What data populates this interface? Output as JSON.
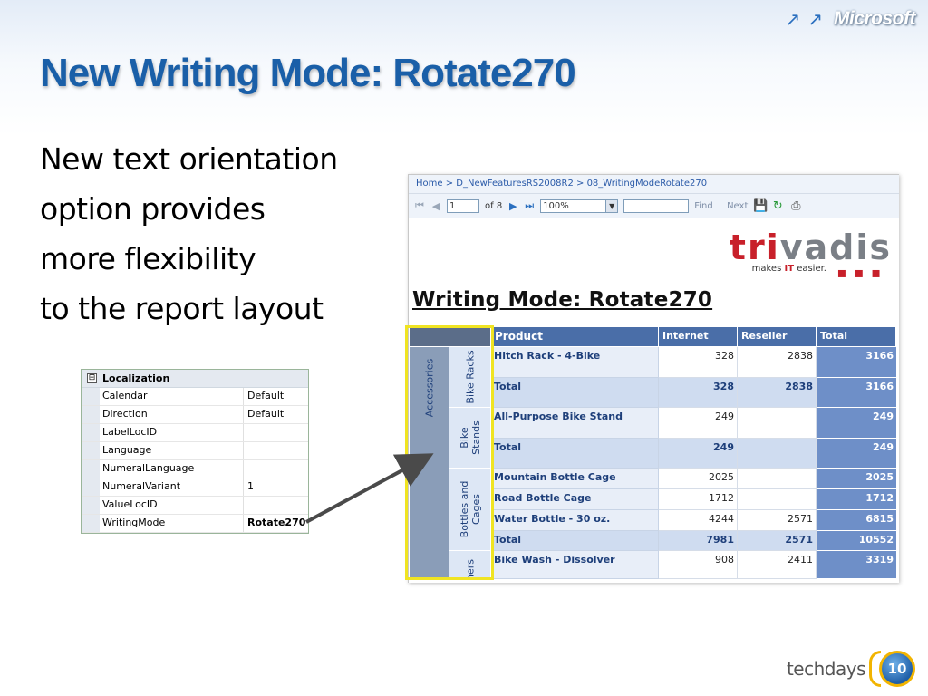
{
  "slide": {
    "title": "New Writing Mode: Rotate270",
    "body_lines": [
      "New text orientation",
      "option provides",
      "more flexibility",
      "to the report layout"
    ],
    "brand_top": "Microsoft",
    "brand_bottom": {
      "word": "techdays",
      "badge": "10"
    }
  },
  "property_grid": {
    "category": "Localization",
    "collapse_glyph": "⊟",
    "rows": [
      {
        "name": "Calendar",
        "value": "Default"
      },
      {
        "name": "Direction",
        "value": "Default"
      },
      {
        "name": "LabelLocID",
        "value": ""
      },
      {
        "name": "Language",
        "value": ""
      },
      {
        "name": "NumeralLanguage",
        "value": ""
      },
      {
        "name": "NumeralVariant",
        "value": "1"
      },
      {
        "name": "ValueLocID",
        "value": ""
      },
      {
        "name": "WritingMode",
        "value": "Rotate270"
      }
    ]
  },
  "viewer": {
    "breadcrumb": "Home > D_NewFeaturesRS2008R2 > 08_WritingModeRotate270",
    "toolbar": {
      "page_value": "1",
      "page_of": "of 8",
      "zoom_value": "100%",
      "find_label": "Find",
      "separator": "|",
      "next_label": "Next"
    },
    "logo": {
      "brand": "trivadis",
      "tagline_pre": "makes ",
      "tagline_it": "IT",
      "tagline_post": " easier."
    },
    "report_title": "Writing Mode: Rotate270"
  },
  "matrix": {
    "headers": {
      "product": "Product",
      "internet": "Internet",
      "reseller": "Reseller",
      "total": "Total"
    },
    "outer_group": "Accessories",
    "inner_groups": [
      {
        "label": "Bike Racks"
      },
      {
        "label": "Bike Stands"
      },
      {
        "label": "Bottles and Cages"
      },
      {
        "label": "ners"
      }
    ],
    "rows": [
      {
        "product": "Hitch Rack - 4-Bike",
        "internet": "328",
        "reseller": "2838",
        "total": "3166",
        "is_total": false
      },
      {
        "product": "Total",
        "internet": "328",
        "reseller": "2838",
        "total": "3166",
        "is_total": true
      },
      {
        "product": "All-Purpose Bike Stand",
        "internet": "249",
        "reseller": "",
        "total": "249",
        "is_total": false
      },
      {
        "product": "Total",
        "internet": "249",
        "reseller": "",
        "total": "249",
        "is_total": true
      },
      {
        "product": "Mountain Bottle Cage",
        "internet": "2025",
        "reseller": "",
        "total": "2025",
        "is_total": false
      },
      {
        "product": "Road Bottle Cage",
        "internet": "1712",
        "reseller": "",
        "total": "1712",
        "is_total": false
      },
      {
        "product": "Water Bottle - 30 oz.",
        "internet": "4244",
        "reseller": "2571",
        "total": "6815",
        "is_total": false
      },
      {
        "product": "Total",
        "internet": "7981",
        "reseller": "2571",
        "total": "10552",
        "is_total": true
      },
      {
        "product": "Bike Wash - Dissolver",
        "internet": "908",
        "reseller": "2411",
        "total": "3319",
        "is_total": false
      }
    ]
  },
  "colors": {
    "title_blue": "#1a5fa8",
    "header_blue": "#4a6ea8",
    "total_column": "#6e8fc8",
    "highlight_yellow": "#f0e422",
    "trivadis_red": "#c8202a"
  }
}
